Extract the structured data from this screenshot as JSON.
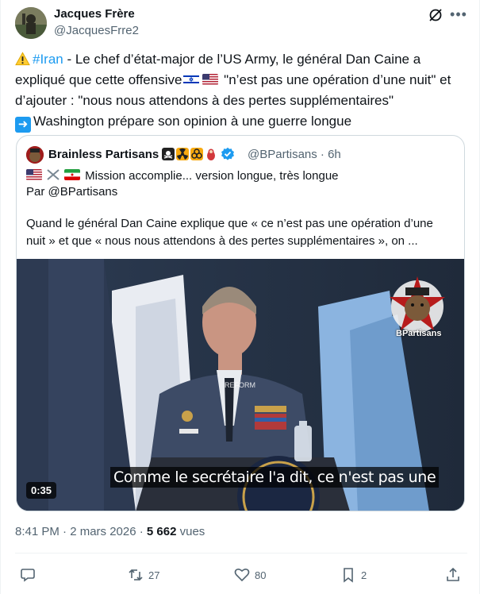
{
  "author": {
    "name": "Jacques Frère",
    "handle": "@JacquesFrre2"
  },
  "tweet": {
    "hashtag": "#Iran",
    "line1_rest": " - Le chef d’état-major de l’US Army, le général Dan Caine a",
    "line2_a": "expliqué que cette offensive",
    "line2_b": " \"n’est pas une opération d’une nuit\" et",
    "line3": "d’ajouter : \"nous nous attendons à des pertes supplémentaires\"",
    "line4": "Washington prépare son opinion à une guerre longue",
    "icons": [
      "warning-icon",
      "israel-flag",
      "us-flag",
      "right-arrow-icon"
    ]
  },
  "quote": {
    "name": "Brainless Partisans",
    "handle": "@BPartisans · 6h",
    "line1": "Mission accomplie... version longue, très longue",
    "line2": "Par @BPartisans",
    "para1": "Quand le général Dan Caine explique que « ce n’est pas une opération d’une",
    "para2": "nuit » et que « nous nous attendons à des pertes supplémentaires », on ...",
    "video": {
      "duration": "0:35",
      "subtitle": "Comme le secrétaire l'a dit, ce n'est pas une",
      "watermark": "BPartisans"
    }
  },
  "meta": {
    "time": "8:41 PM · 2 mars 2026 · ",
    "views_count": "5 662",
    "views_label": " vues"
  },
  "actions": {
    "replies": "",
    "reposts": "27",
    "likes": "80",
    "bookmarks": "2"
  },
  "colors": {
    "accent": "#1d9bf0",
    "text": "#0f1419",
    "secondary": "#536471",
    "border": "#cfd9de"
  }
}
